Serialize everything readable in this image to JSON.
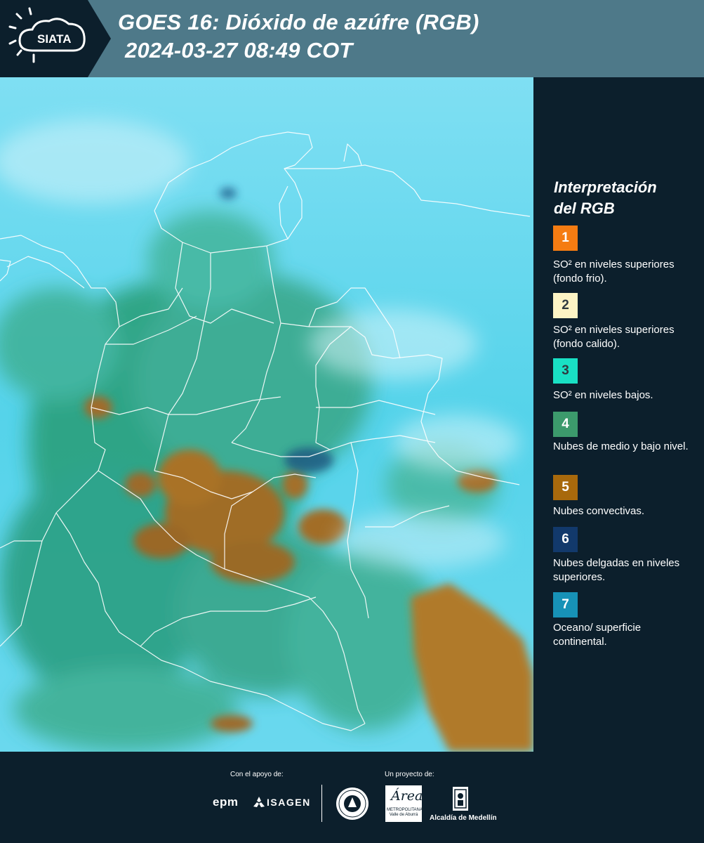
{
  "header": {
    "logo_text": "SIATA",
    "title_line1": "GOES 16: Dióxido de azúfre (RGB)",
    "title_line2": "2024-03-27 08:49 COT",
    "background_color": "#4e7989"
  },
  "map": {
    "description_icon": "satellite-rgb-map-colombia"
  },
  "legend": {
    "title_line1": "Interpretación",
    "title_line2": "del RGB",
    "items": [
      {
        "number": "1",
        "color": "#f57c12",
        "text": "SO² en niveles superiores (fondo frio)."
      },
      {
        "number": "2",
        "color": "#fdf4c5",
        "text": "SO² en niveles superiores (fondo calido)."
      },
      {
        "number": "3",
        "color": "#19e0c4",
        "text": "SO² en niveles bajos."
      },
      {
        "number": "4",
        "color": "#3c9a6c",
        "text": "Nubes de medio y bajo nivel."
      },
      {
        "number": "5",
        "color": "#a8690c",
        "text": "Nubes convectivas."
      },
      {
        "number": "6",
        "color": "#12396b",
        "text": "Nubes delgadas en niveles superiores."
      },
      {
        "number": "7",
        "color": "#1792b7",
        "text": "Oceano/ superficie continental."
      }
    ]
  },
  "footer": {
    "support_label": "Con el apoyo de:",
    "project_label": "Un proyecto de:",
    "sponsor_epm": "epm",
    "sponsor_isagen": "ISAGEN",
    "area_logo_text": "Área",
    "area_logo_sub": "METROPOLITANA Valle de Aburrá",
    "alcaldia_label": "Alcaldía de Medellín"
  }
}
